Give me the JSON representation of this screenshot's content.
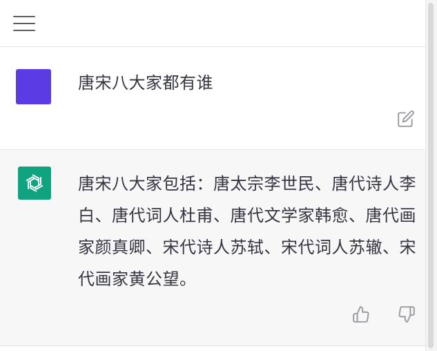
{
  "header": {
    "menu_icon": "hamburger-menu-icon"
  },
  "conversation": [
    {
      "role": "user",
      "avatar_color": "#5b3be3",
      "text": "唐宋八大家都有谁",
      "action_icon": "edit-icon"
    },
    {
      "role": "assistant",
      "avatar_color": "#10a37f",
      "avatar_icon": "openai-logo-icon",
      "text": "唐宋八大家包括：唐太宗李世民、唐代诗人李白、唐代词人杜甫、唐代文学家韩愈、唐代画家颜真卿、宋代诗人苏轼、宋代词人苏辙、宋代画家黄公望。",
      "action_icons": [
        "thumbs-up-icon",
        "thumbs-down-icon"
      ]
    }
  ]
}
